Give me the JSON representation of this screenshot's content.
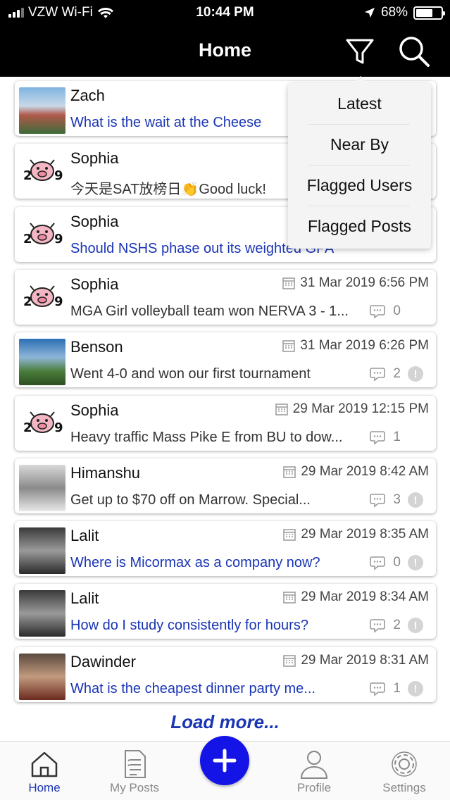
{
  "status_bar": {
    "carrier": "VZW Wi-Fi",
    "time": "10:44 PM",
    "battery": "68%",
    "battery_level": 0.68
  },
  "header": {
    "title": "Home",
    "icons": [
      "filter-icon",
      "search-icon"
    ]
  },
  "filter_menu": {
    "items": [
      "Latest",
      "Near By",
      "Flagged Users",
      "Flagged Posts"
    ]
  },
  "posts": [
    {
      "name": "Zach",
      "date": "",
      "message": "What is the wait at the Cheese",
      "is_question": true,
      "comments": "",
      "flag": false
    },
    {
      "name": "Sophia",
      "date": "",
      "message": "今天是SAT放榜日👏Good luck!",
      "is_question": false,
      "comments": "",
      "flag": false
    },
    {
      "name": "Sophia",
      "date": "",
      "message": "Should NSHS phase out its weighted GPA",
      "is_question": true,
      "comments": "",
      "flag": false
    },
    {
      "name": "Sophia",
      "date": "31 Mar 2019 6:56 PM",
      "message": "MGA Girl volleyball team won NERVA 3 - 1...",
      "is_question": false,
      "comments": "0",
      "flag": false
    },
    {
      "name": "Benson",
      "date": "31 Mar 2019 6:26 PM",
      "message": "Went 4-0 and won our first tournament",
      "is_question": false,
      "comments": "2",
      "flag": true
    },
    {
      "name": "Sophia",
      "date": "29 Mar 2019 12:15 PM",
      "message": "Heavy traffic Mass Pike E from BU to dow...",
      "is_question": false,
      "comments": "1",
      "flag": false
    },
    {
      "name": "Himanshu",
      "date": "29 Mar 2019 8:42 AM",
      "message": "Get up to $70 off on Marrow. Special...",
      "is_question": false,
      "comments": "3",
      "flag": true
    },
    {
      "name": "Lalit",
      "date": "29 Mar 2019 8:35 AM",
      "message": "Where is Micormax as a company now?",
      "is_question": true,
      "comments": "0",
      "flag": true
    },
    {
      "name": "Lalit",
      "date": "29 Mar 2019 8:34 AM",
      "message": "How do I study consistently for hours?",
      "is_question": true,
      "comments": "2",
      "flag": true
    },
    {
      "name": "Dawinder",
      "date": "29 Mar 2019 8:31 AM",
      "message": "What is the cheapest dinner party me...",
      "is_question": true,
      "comments": "1",
      "flag": true
    }
  ],
  "load_more": "Load more...",
  "tabs": [
    {
      "label": "Home",
      "icon": "home-icon",
      "active": true
    },
    {
      "label": "My Posts",
      "icon": "document-icon",
      "active": false
    },
    {
      "label": "Profile",
      "icon": "person-icon",
      "active": false
    },
    {
      "label": "Settings",
      "icon": "gear-icon",
      "active": false
    }
  ],
  "colors": {
    "accent": "#1a35b5",
    "fab": "#1414e6",
    "header_bg": "#000000"
  }
}
